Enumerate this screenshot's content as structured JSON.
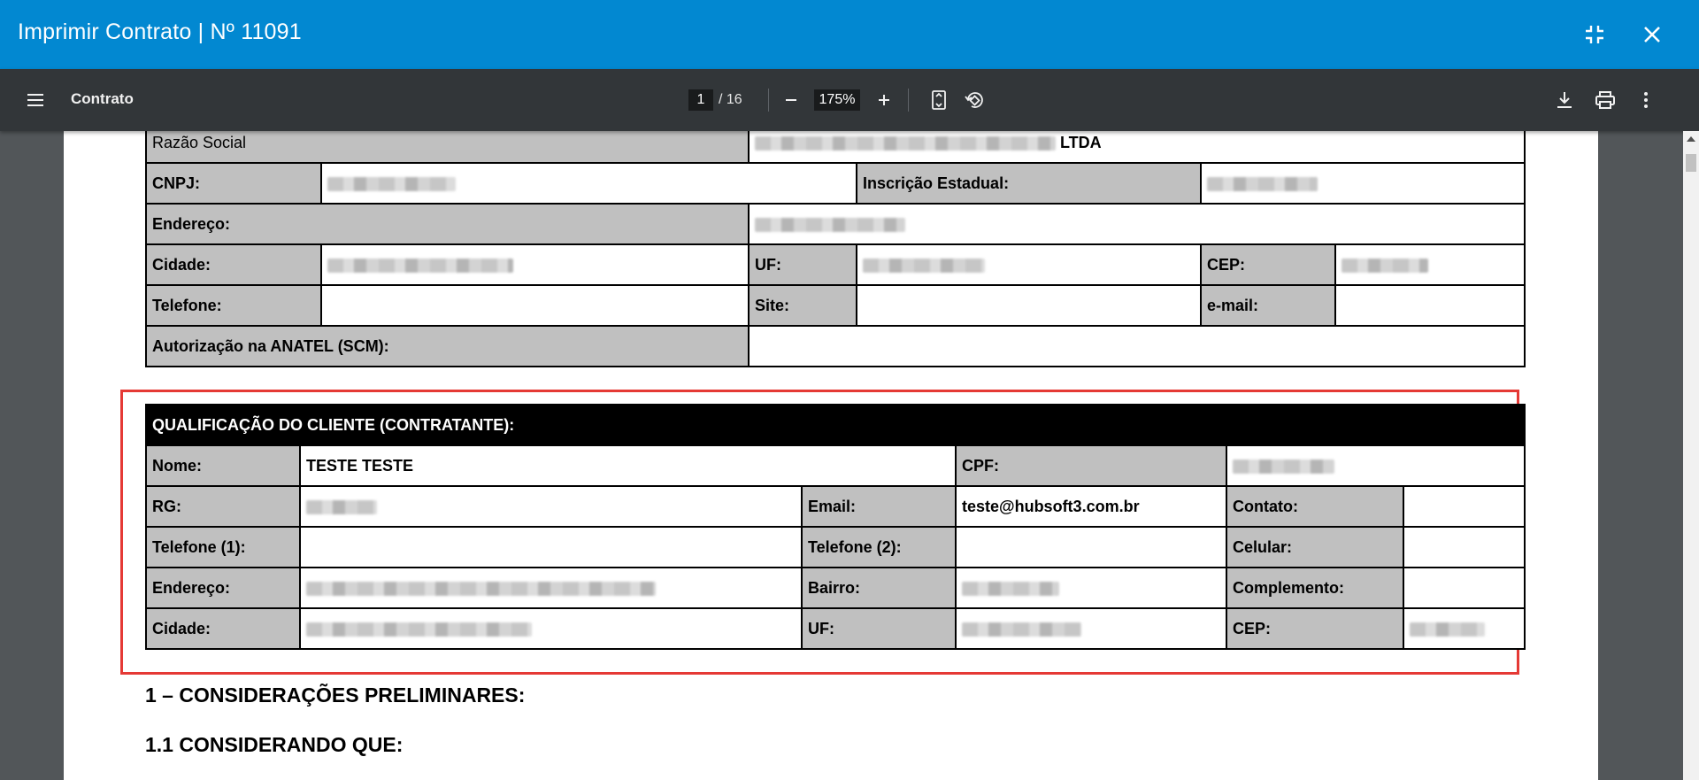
{
  "dialog": {
    "title": "Imprimir Contrato | Nº 11091"
  },
  "viewer": {
    "document_name": "Contrato",
    "current_page": "1",
    "page_total": "/ 16",
    "zoom": "175%"
  },
  "empresa": {
    "razao_social_label": "Razão Social",
    "razao_social_suffix": "LTDA",
    "cnpj_label": "CNPJ:",
    "ie_label": "Inscrição Estadual:",
    "endereco_label": "Endereço:",
    "cidade_label": "Cidade:",
    "uf_label": "UF:",
    "cep_label": "CEP:",
    "telefone_label": "Telefone:",
    "site_label": "Site:",
    "email_label": "e-mail:",
    "anatel_label": "Autorização na ANATEL (SCM):"
  },
  "cliente": {
    "header": "QUALIFICAÇÃO DO CLIENTE (CONTRATANTE):",
    "nome_label": "Nome:",
    "nome_value": "TESTE TESTE",
    "cpf_label": "CPF:",
    "rg_label": "RG:",
    "email_label": "Email:",
    "email_value": "teste@hubsoft3.com.br",
    "contato_label": "Contato:",
    "telefone1_label": "Telefone (1):",
    "telefone2_label": "Telefone (2):",
    "celular_label": "Celular:",
    "endereco_label": "Endereço:",
    "bairro_label": "Bairro:",
    "complemento_label": "Complemento:",
    "cidade_label": "Cidade:",
    "uf_label": "UF:",
    "cep_label": "CEP:"
  },
  "sections": {
    "s1": "1 – CONSIDERAÇÕES PRELIMINARES:",
    "s1_1": "1.1 CONSIDERANDO QUE:"
  },
  "colors": {
    "titlebar": "#0288d1",
    "toolbar": "#323639",
    "cell_gray": "#c0c0c0",
    "highlight": "#e53935"
  }
}
